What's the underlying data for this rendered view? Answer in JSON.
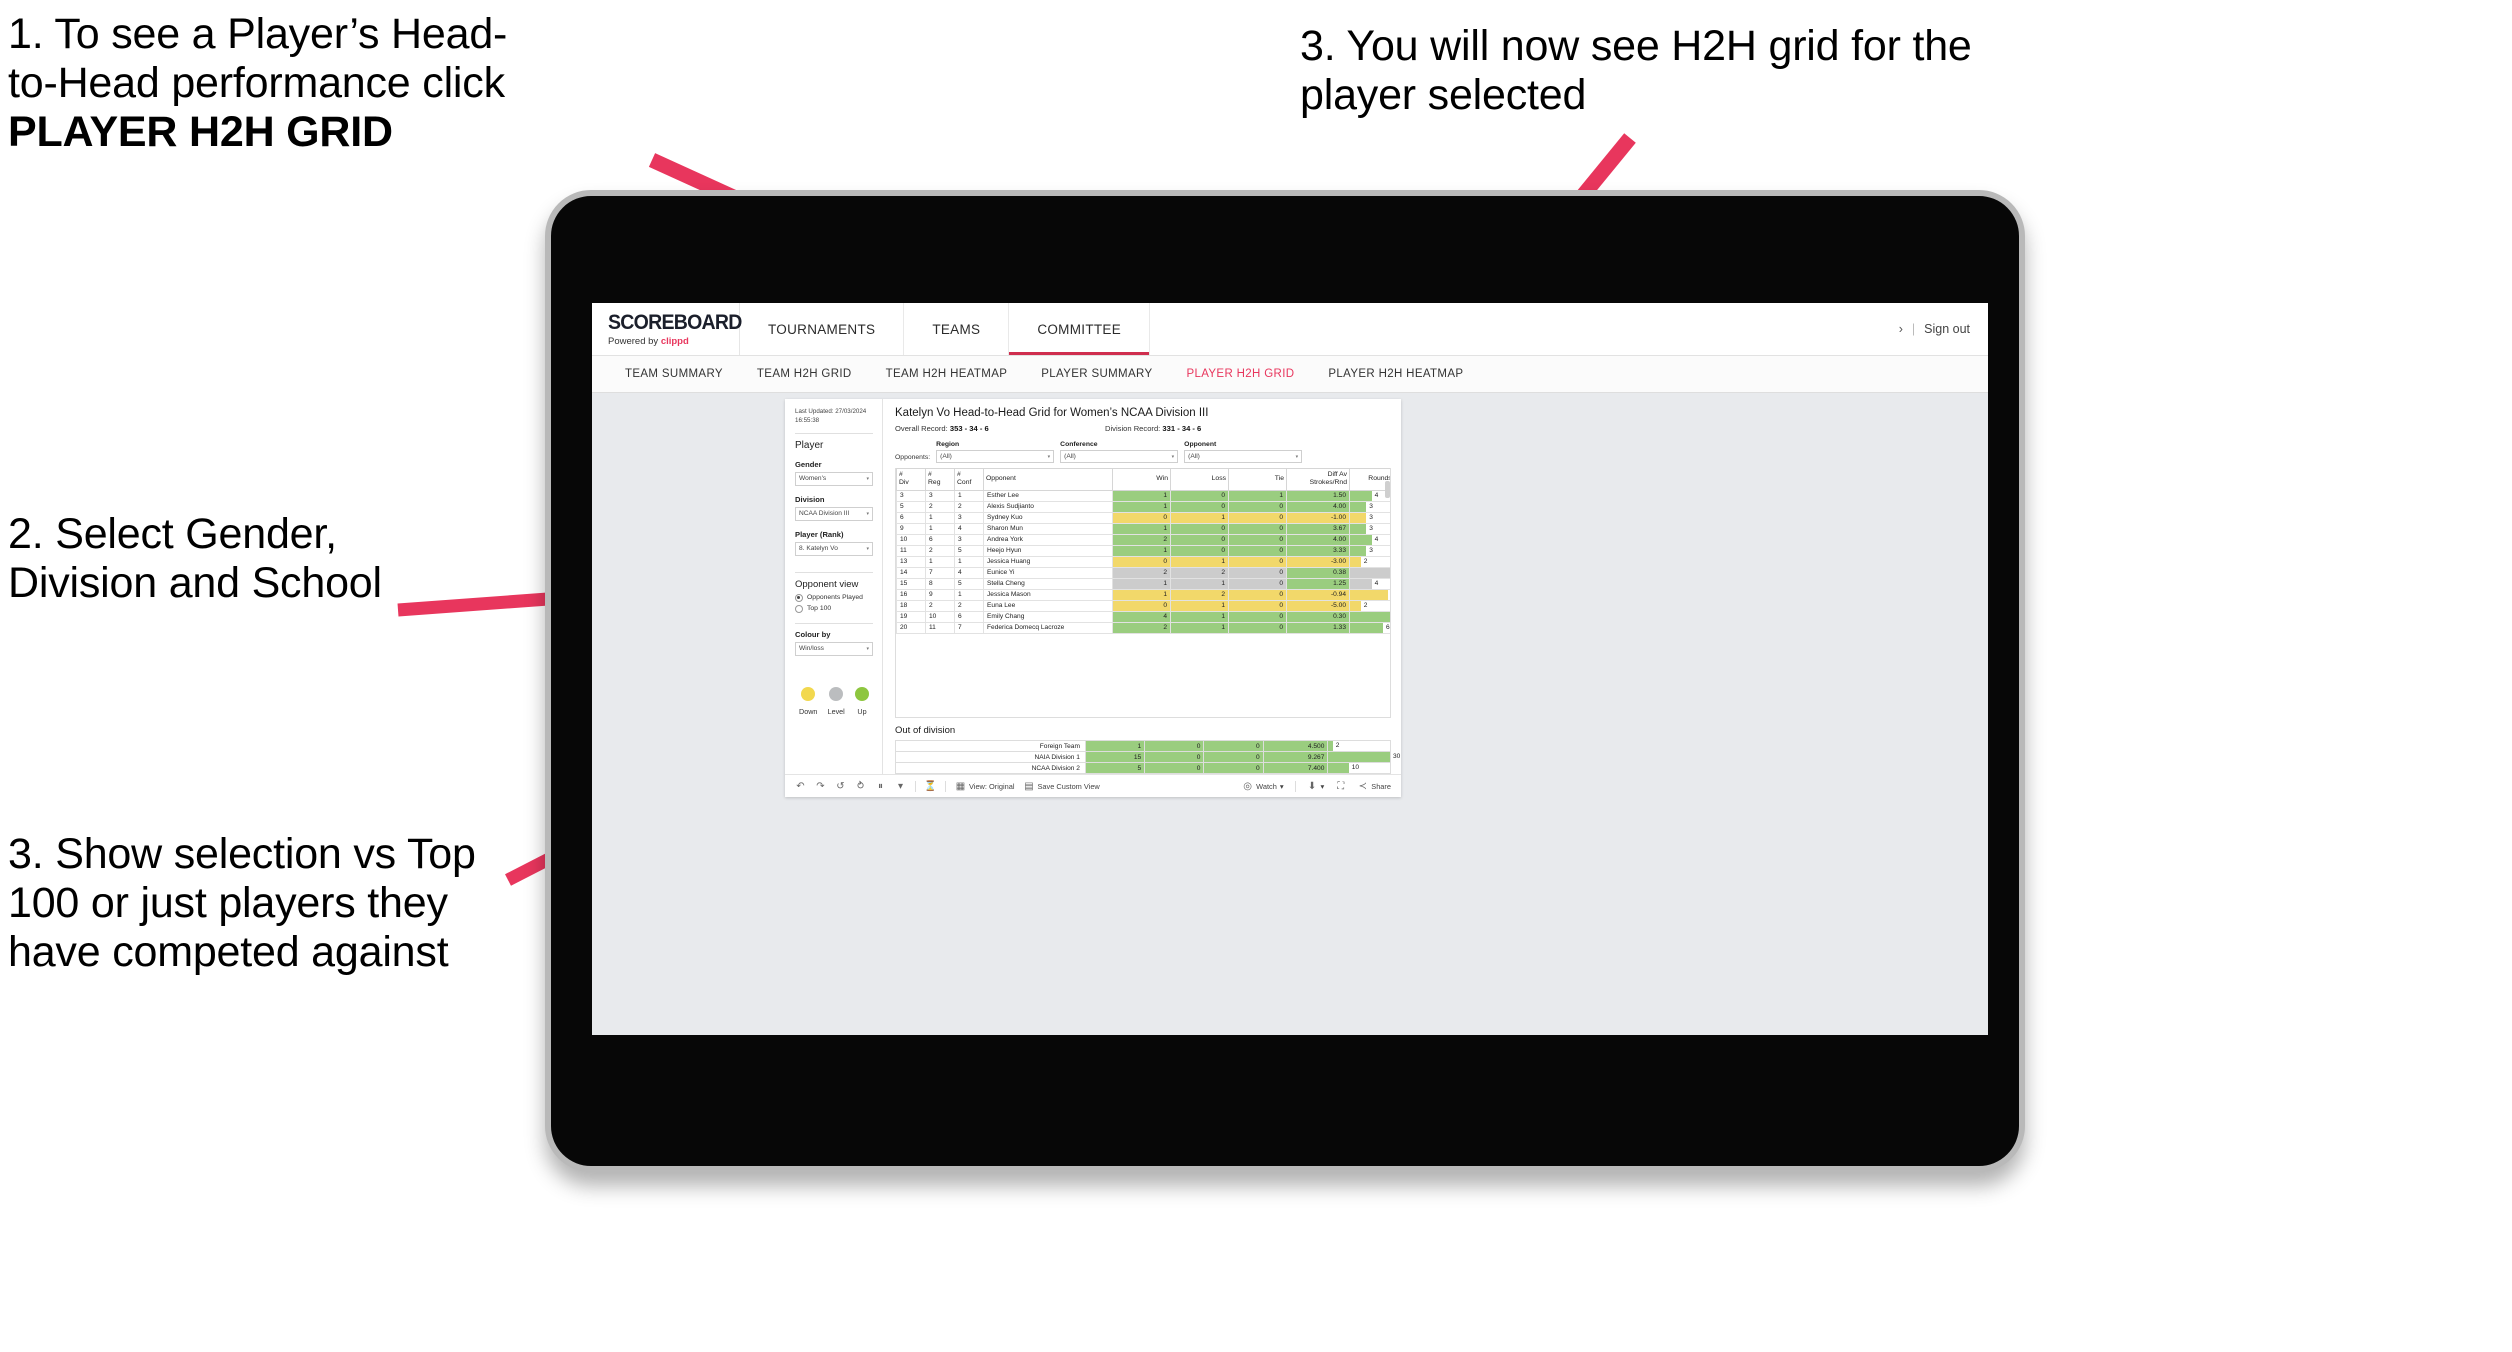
{
  "annotations": {
    "a1_line1": "1. To see a Player’s Head-",
    "a1_line2": "to-Head performance click",
    "a1_bold": "PLAYER H2H GRID",
    "a2": "2. Select Gender, Division and School",
    "a3": "3. Show selection vs Top 100 or just players they have competed against",
    "a4": "3. You will now see H2H grid for the player selected"
  },
  "header": {
    "logo_main": "SCOREBOARD",
    "logo_sub_prefix": "Powered by ",
    "logo_sub_brand": "clippd",
    "nav": [
      {
        "label": "TOURNAMENTS",
        "active": false
      },
      {
        "label": "TEAMS",
        "active": false
      },
      {
        "label": "COMMITTEE",
        "active": true
      }
    ],
    "user_chevron": "›",
    "separator": "|",
    "sign_out": "Sign out"
  },
  "subnav": [
    {
      "label": "TEAM SUMMARY",
      "active": false
    },
    {
      "label": "TEAM H2H GRID",
      "active": false
    },
    {
      "label": "TEAM H2H HEATMAP",
      "active": false
    },
    {
      "label": "PLAYER SUMMARY",
      "active": false
    },
    {
      "label": "PLAYER H2H GRID",
      "active": true
    },
    {
      "label": "PLAYER H2H HEATMAP",
      "active": false
    }
  ],
  "sidebar": {
    "last_updated": "Last Updated: 27/03/2024 16:55:38",
    "section_player": "Player",
    "gender": {
      "label": "Gender",
      "value": "Women's"
    },
    "division": {
      "label": "Division",
      "value": "NCAA Division III"
    },
    "player_rank": {
      "label": "Player (Rank)",
      "value": "8. Katelyn Vo"
    },
    "opponent_view": {
      "title": "Opponent view",
      "options": [
        {
          "label": "Opponents Played",
          "selected": true
        },
        {
          "label": "Top 100",
          "selected": false
        }
      ]
    },
    "colour_by": {
      "label": "Colour by",
      "value": "Win/loss"
    },
    "legend": [
      {
        "label": "Down",
        "color": "#F2D84E"
      },
      {
        "label": "Level",
        "color": "#BBBDBF"
      },
      {
        "label": "Up",
        "color": "#8DC63F"
      }
    ]
  },
  "main": {
    "title": "Katelyn Vo Head-to-Head Grid for Women’s NCAA Division III",
    "overall_record_label": "Overall Record:",
    "overall_record_value": "353 -  34 - 6",
    "division_record_label": "Division Record:",
    "division_record_value": "331 -  34 - 6",
    "opponents_label": "Opponents:",
    "filters": [
      {
        "caption": "Region",
        "value": "(All)"
      },
      {
        "caption": "Conference",
        "value": "(All)"
      },
      {
        "caption": "Opponent",
        "value": "(All)"
      }
    ],
    "out_of_division_title": "Out of division"
  },
  "chart_data": {
    "type": "table",
    "title": "Katelyn Vo Head-to-Head Grid for Women’s NCAA Division III",
    "columns": [
      "# Div",
      "# Reg",
      "# Conf",
      "Opponent",
      "Win",
      "Loss",
      "Tie",
      "Diff Av Strokes/Rnd",
      "Rounds"
    ],
    "column_header_lines": [
      [
        "#",
        "Div"
      ],
      [
        "#",
        "Reg"
      ],
      [
        "#",
        "Conf"
      ],
      [
        "Opponent"
      ],
      [
        "Win"
      ],
      [
        "Loss"
      ],
      [
        "Tie"
      ],
      [
        "Diff Av",
        "Strokes/Rnd"
      ],
      [
        "Rounds"
      ]
    ],
    "rounds_max": 11,
    "rows": [
      {
        "div": "3",
        "reg": "3",
        "conf": "1",
        "opponent": "Esther Lee",
        "win": "1",
        "loss": "0",
        "tie": "1",
        "diff": "1.50",
        "rounds": 4,
        "color": "#9ACD7F"
      },
      {
        "div": "5",
        "reg": "2",
        "conf": "2",
        "opponent": "Alexis Sudjianto",
        "win": "1",
        "loss": "0",
        "tie": "0",
        "diff": "4.00",
        "rounds": 3,
        "color": "#9ACD7F"
      },
      {
        "div": "6",
        "reg": "1",
        "conf": "3",
        "opponent": "Sydney Kuo",
        "win": "0",
        "loss": "1",
        "tie": "0",
        "diff": "-1.00",
        "rounds": 3,
        "color": "#F2D86A"
      },
      {
        "div": "9",
        "reg": "1",
        "conf": "4",
        "opponent": "Sharon Mun",
        "win": "1",
        "loss": "0",
        "tie": "0",
        "diff": "3.67",
        "rounds": 3,
        "color": "#9ACD7F"
      },
      {
        "div": "10",
        "reg": "6",
        "conf": "3",
        "opponent": "Andrea York",
        "win": "2",
        "loss": "0",
        "tie": "0",
        "diff": "4.00",
        "rounds": 4,
        "color": "#9ACD7F"
      },
      {
        "div": "11",
        "reg": "2",
        "conf": "5",
        "opponent": "Heejo Hyun",
        "win": "1",
        "loss": "0",
        "tie": "0",
        "diff": "3.33",
        "rounds": 3,
        "color": "#9ACD7F"
      },
      {
        "div": "13",
        "reg": "1",
        "conf": "1",
        "opponent": "Jessica Huang",
        "win": "0",
        "loss": "1",
        "tie": "0",
        "diff": "-3.00",
        "rounds": 2,
        "color": "#F2D86A"
      },
      {
        "div": "14",
        "reg": "7",
        "conf": "4",
        "opponent": "Eunice Yi",
        "win": "2",
        "loss": "2",
        "tie": "0",
        "diff": "0.38",
        "rounds": 9,
        "color": "#CCCCCC",
        "diff_color": "#9ACD7F"
      },
      {
        "div": "15",
        "reg": "8",
        "conf": "5",
        "opponent": "Stella Cheng",
        "win": "1",
        "loss": "1",
        "tie": "0",
        "diff": "1.25",
        "rounds": 4,
        "color": "#CCCCCC",
        "diff_color": "#9ACD7F"
      },
      {
        "div": "16",
        "reg": "9",
        "conf": "1",
        "opponent": "Jessica Mason",
        "win": "1",
        "loss": "2",
        "tie": "0",
        "diff": "-0.94",
        "rounds": 7,
        "color": "#F2D86A"
      },
      {
        "div": "18",
        "reg": "2",
        "conf": "2",
        "opponent": "Euna Lee",
        "win": "0",
        "loss": "1",
        "tie": "0",
        "diff": "-5.00",
        "rounds": 2,
        "color": "#F2D86A"
      },
      {
        "div": "19",
        "reg": "10",
        "conf": "6",
        "opponent": "Emily Chang",
        "win": "4",
        "loss": "1",
        "tie": "0",
        "diff": "0.30",
        "rounds": 11,
        "color": "#9ACD7F"
      },
      {
        "div": "20",
        "reg": "11",
        "conf": "7",
        "opponent": "Federica Domecq Lacroze",
        "win": "2",
        "loss": "1",
        "tie": "0",
        "diff": "1.33",
        "rounds": 6,
        "color": "#9ACD7F"
      }
    ],
    "out_of_division": {
      "rounds_max": 30,
      "rows": [
        {
          "name": "Foreign Team",
          "win": "1",
          "loss": "0",
          "tie": "0",
          "diff": "4.500",
          "rounds": 2,
          "color": "#9ACD7F"
        },
        {
          "name": "NAIA Division 1",
          "win": "15",
          "loss": "0",
          "tie": "0",
          "diff": "9.267",
          "rounds": 30,
          "color": "#9ACD7F"
        },
        {
          "name": "NCAA Division 2",
          "win": "5",
          "loss": "0",
          "tie": "0",
          "diff": "7.400",
          "rounds": 10,
          "color": "#9ACD7F"
        }
      ]
    }
  },
  "toolbar": {
    "undo": "↶",
    "redo": "↷",
    "revert": "↺",
    "refresh": "⥁",
    "pause": "⏸",
    "custom_caret": "▾",
    "view_label": "View: Original",
    "save_custom_view": "Save Custom View",
    "watch": "Watch",
    "watch_caret": "▾",
    "download_caret": "▾",
    "share": "Share"
  },
  "colors": {
    "accent": "#e8365d",
    "green": "#9ACD7F",
    "yellow": "#F2D86A",
    "grey": "#CCCCCC"
  }
}
